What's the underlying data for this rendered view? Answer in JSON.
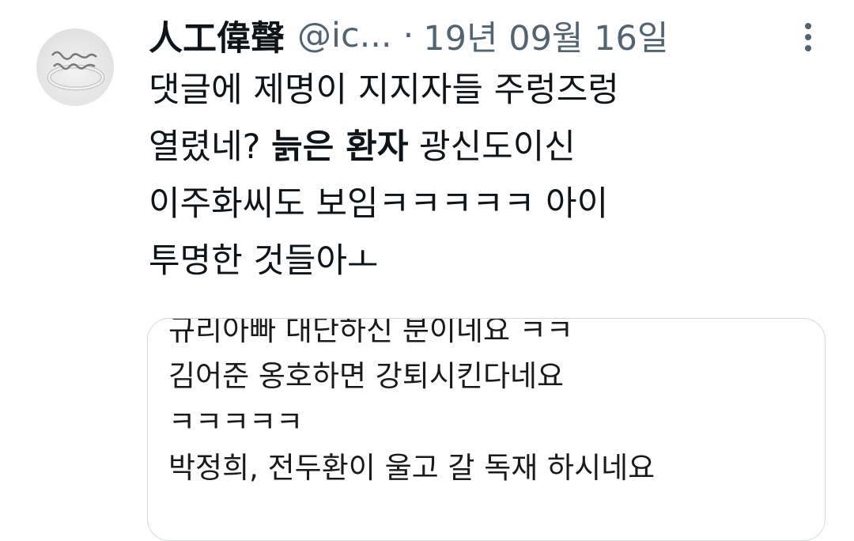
{
  "author": {
    "display_name": "人工偉聲",
    "handle": "@ic...",
    "separator": "·",
    "date": "19년 09월 16일"
  },
  "icons": {
    "more": "more-vertical-icon",
    "avatar": "ring-photo-avatar"
  },
  "tweet": {
    "lines": [
      {
        "parts": [
          {
            "text": "댓글에 제명이 지지자들 주렁즈렁",
            "bold": false
          }
        ]
      },
      {
        "parts": [
          {
            "text": "열렸네? ",
            "bold": false
          },
          {
            "text": "늙은 환자",
            "bold": true
          },
          {
            "text": " 광신도이신",
            "bold": false
          }
        ]
      },
      {
        "parts": [
          {
            "text": "이주화씨도 보임ㅋㅋㅋㅋㅋ 아이",
            "bold": false
          }
        ]
      },
      {
        "parts": [
          {
            "text": "투명한 것들아ㅗ",
            "bold": false
          }
        ]
      }
    ]
  },
  "quote": {
    "lines": [
      "규리아빠 대단하신 분이네요 ㅋㅋ",
      "김어준 옹호하면 강퇴시킨다네요",
      "ㅋㅋㅋㅋㅋ",
      "박정희, 전두환이 울고 갈 독재 하시네요"
    ]
  },
  "colors": {
    "text": "#0f1419",
    "secondary": "#536471",
    "border": "#cfd9de"
  }
}
